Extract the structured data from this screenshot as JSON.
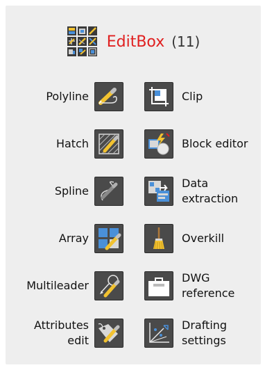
{
  "header": {
    "icon": "editbox-grid-icon",
    "name": "EditBox",
    "count": "(11)"
  },
  "tools_left": [
    {
      "label_lines": [
        "Polyline"
      ],
      "icon": "polyline-icon"
    },
    {
      "label_lines": [
        "Hatch"
      ],
      "icon": "hatch-icon"
    },
    {
      "label_lines": [
        "Spline"
      ],
      "icon": "spline-icon"
    },
    {
      "label_lines": [
        "Array"
      ],
      "icon": "array-icon"
    },
    {
      "label_lines": [
        "Multileader"
      ],
      "icon": "multileader-icon"
    },
    {
      "label_lines": [
        "Attributes",
        "edit"
      ],
      "icon": "attributes-edit-icon"
    }
  ],
  "tools_right": [
    {
      "label_lines": [
        "Clip"
      ],
      "icon": "clip-icon"
    },
    {
      "label_lines": [
        "Block editor"
      ],
      "icon": "block-editor-icon"
    },
    {
      "label_lines": [
        "Data",
        "extraction"
      ],
      "icon": "data-extraction-icon"
    },
    {
      "label_lines": [
        "Overkill"
      ],
      "icon": "overkill-icon"
    },
    {
      "label_lines": [
        "DWG",
        "reference"
      ],
      "icon": "dwg-reference-icon"
    },
    {
      "label_lines": [
        "Drafting",
        "settings"
      ],
      "icon": "drafting-settings-icon"
    }
  ],
  "colors": {
    "title": "#e02020",
    "icon_background": "#4a4a4a",
    "panel_background": "#eeeeee"
  }
}
